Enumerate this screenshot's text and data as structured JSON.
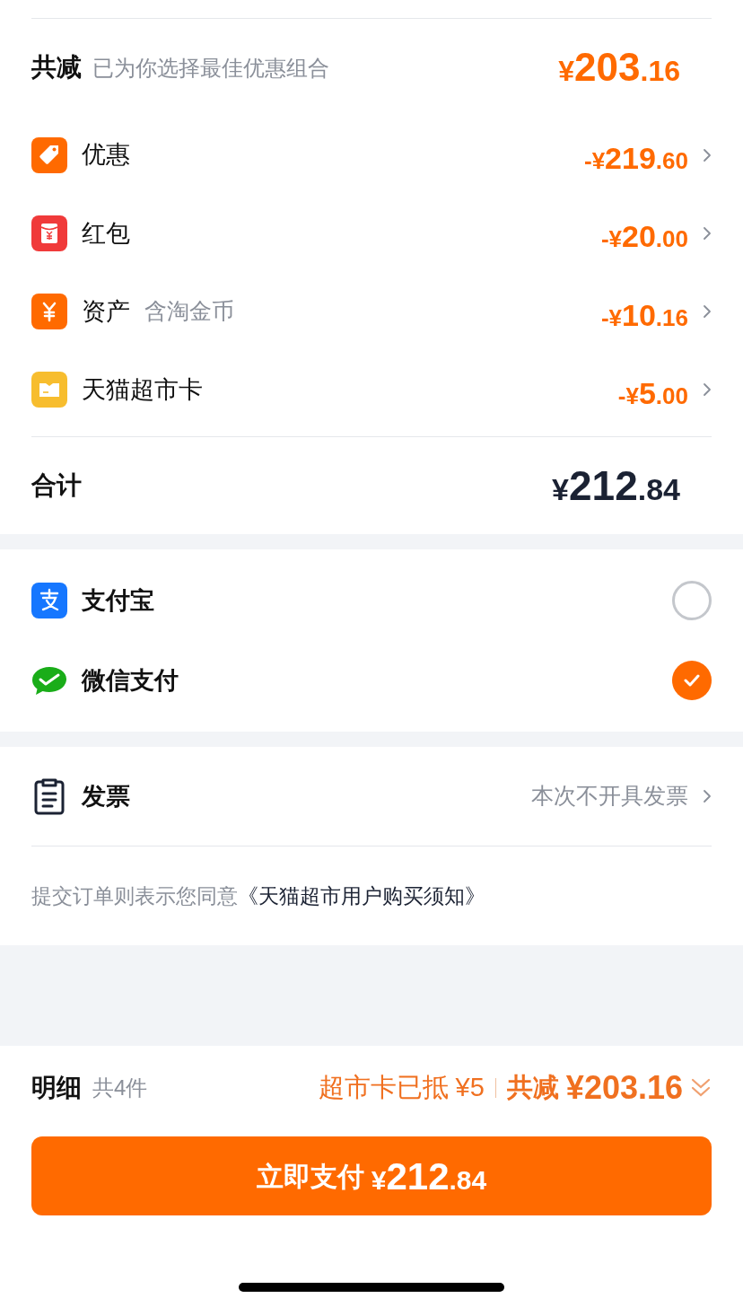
{
  "summary": {
    "label": "共减",
    "hint": "已为你选择最佳优惠组合",
    "amount": "¥203.16"
  },
  "discounts": [
    {
      "kind": "coupon",
      "label": "优惠",
      "amount": "-¥219.60"
    },
    {
      "kind": "redpacket",
      "label": "红包",
      "amount": "-¥20.00"
    },
    {
      "kind": "asset",
      "label": "资产",
      "note": "含淘金币",
      "amount": "-¥10.16"
    },
    {
      "kind": "card",
      "label": "天猫超市卡",
      "amount": "-¥5.00"
    }
  ],
  "total": {
    "label": "合计",
    "amount": "¥212.84"
  },
  "payment_methods": [
    {
      "kind": "alipay",
      "label": "支付宝",
      "selected": false
    },
    {
      "kind": "wechat",
      "label": "微信支付",
      "selected": true
    }
  ],
  "invoice": {
    "label": "发票",
    "value": "本次不开具发票"
  },
  "agreement": {
    "text": "提交订单则表示您同意",
    "link": "《天猫超市用户购买须知》"
  },
  "footer": {
    "label": "明细",
    "count": "共4件",
    "card_note": "超市卡已抵 ¥5",
    "saving_label": "共减",
    "saving_amount": "¥203.16",
    "pay_label": "立即支付",
    "pay_amount": "¥212.84"
  }
}
